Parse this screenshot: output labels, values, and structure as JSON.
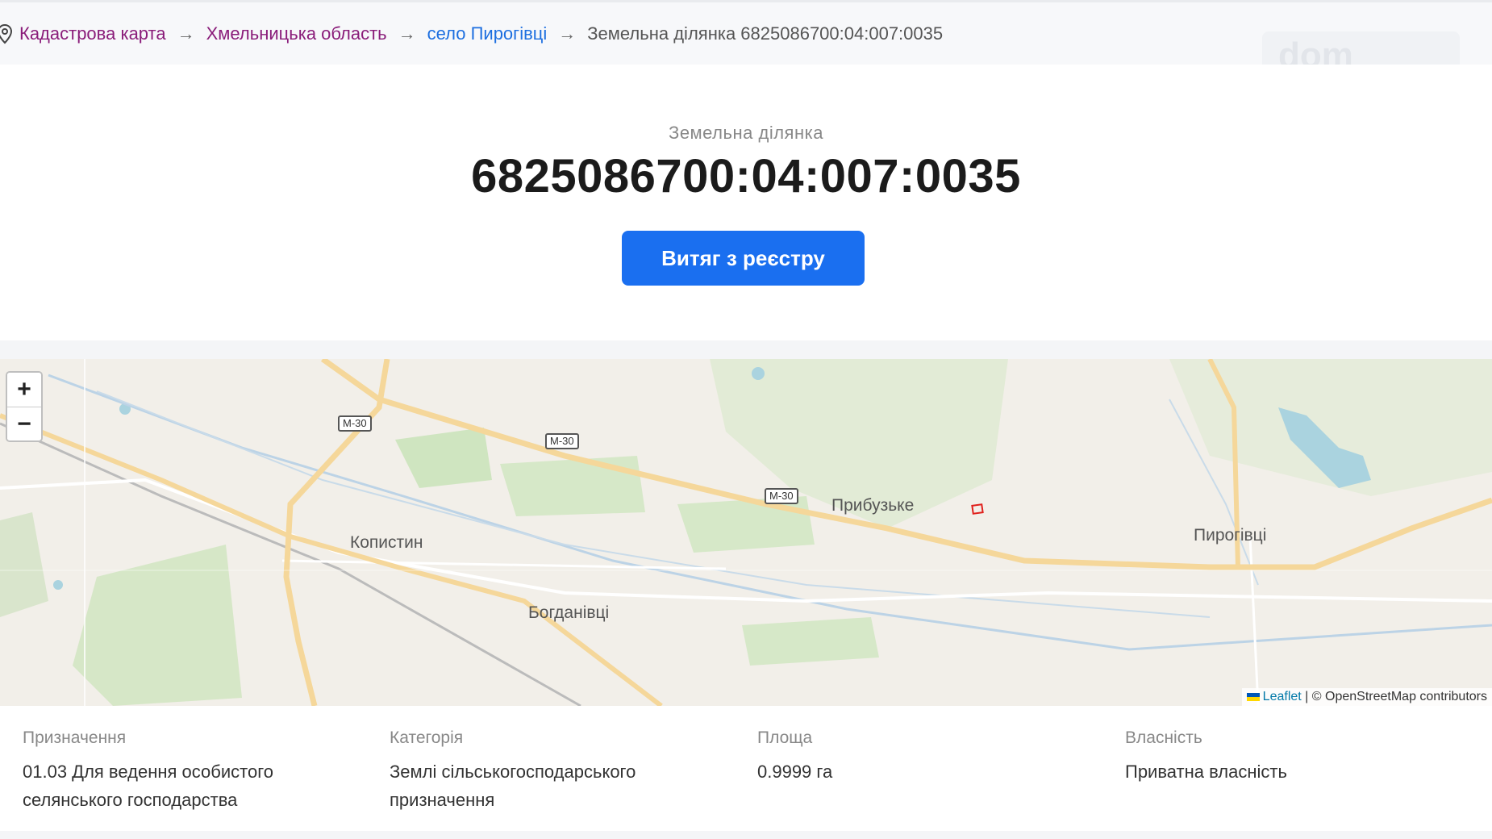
{
  "breadcrumb": {
    "items": [
      "Кадастрова карта",
      "Хмельницька область",
      "село Пирогівці"
    ],
    "separator": "→",
    "current": "Земельна ділянка 6825086700:04:007:0035",
    "icon": "map-pin-icon"
  },
  "watermark": "dom",
  "parcel": {
    "kind": "Земельна ділянка",
    "cadastral_number": "6825086700:04:007:0035",
    "extract_button": "Витяг з реєстру"
  },
  "map": {
    "zoom_in": "+",
    "zoom_out": "−",
    "places": [
      "Прибузьке",
      "Пирогівці",
      "Копистин",
      "Богданівці"
    ],
    "road_labels": [
      "М-30",
      "М-30",
      "М-30"
    ],
    "attribution_link": "Leaflet",
    "attribution_text": "| © OpenStreetMap contributors",
    "parcel_color": "#e0201c"
  },
  "details": [
    {
      "label": "Призначення",
      "value": "01.03 Для ведення особистого селянського господарства"
    },
    {
      "label": "Категорія",
      "value": "Землі сільськогосподарського призначення"
    },
    {
      "label": "Площа",
      "value": "0.9999 га"
    },
    {
      "label": "Власність",
      "value": "Приватна власність"
    }
  ],
  "colors": {
    "accent": "#1a6ff0",
    "crumb_link": "#8a1d7a",
    "crumb_link_active": "#1d6fe0"
  }
}
